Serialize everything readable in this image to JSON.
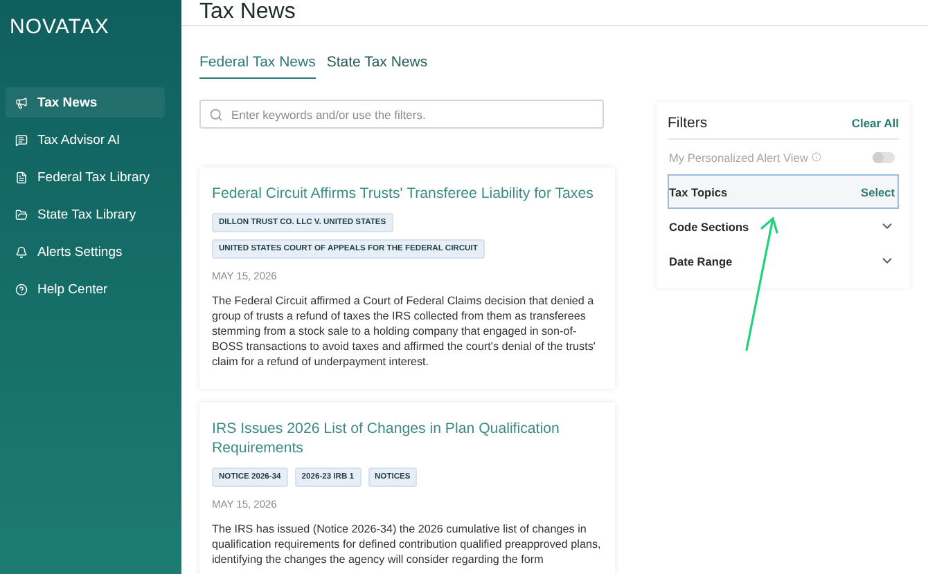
{
  "sidebar": {
    "logo": "NOVATAX",
    "items": [
      {
        "label": "Tax News",
        "selected": true
      },
      {
        "label": "Tax Advisor AI",
        "selected": false
      },
      {
        "label": "Federal Tax Library",
        "selected": false
      },
      {
        "label": "State Tax Library",
        "selected": false
      },
      {
        "label": "Alerts Settings",
        "selected": false
      },
      {
        "label": "Help Center",
        "selected": false
      }
    ]
  },
  "header": {
    "title": "Tax News"
  },
  "tabs": [
    {
      "label": "Federal Tax News",
      "selected": true
    },
    {
      "label": "State Tax News",
      "selected": false
    }
  ],
  "search": {
    "placeholder": "Enter keywords and/or use the filters."
  },
  "articles": [
    {
      "title": "Federal Circuit Affirms Trusts' Transferee Liability for Taxes",
      "tags": [
        "DILLON TRUST CO. LLC V. UNITED STATES",
        "UNITED STATES COURT OF APPEALS FOR THE FEDERAL CIRCUIT"
      ],
      "date": "MAY 15, 2026",
      "summary": "The Federal Circuit affirmed a Court of Federal Claims decision that denied a group of trusts a refund of taxes the IRS collected from them as transferees stemming from a stock sale to a holding company that engaged in son-of-BOSS transactions to avoid taxes and affirmed the court's denial of the trusts' claim for a refund of underpayment interest."
    },
    {
      "title": "IRS Issues 2026 List of Changes in Plan Qualification Requirements",
      "tags": [
        "NOTICE 2026-34",
        "2026-23 IRB 1",
        "NOTICES"
      ],
      "date": "MAY 15, 2026",
      "summary": "The IRS has issued (Notice 2026-34) the 2026 cumulative list of changes in qualification requirements for defined contribution qualified preapproved plans, identifying the changes the agency will consider regarding the form"
    }
  ],
  "filters": {
    "title": "Filters",
    "clear": "Clear All",
    "alert_view": {
      "label": "My Personalized Alert View",
      "on": false
    },
    "items": [
      {
        "kind": "select",
        "label": "Tax Topics",
        "action": "Select",
        "selected": true
      },
      {
        "kind": "dropdown",
        "label": "Code Sections",
        "selected": false
      },
      {
        "kind": "dropdown",
        "label": "Date Range",
        "selected": false
      }
    ]
  }
}
